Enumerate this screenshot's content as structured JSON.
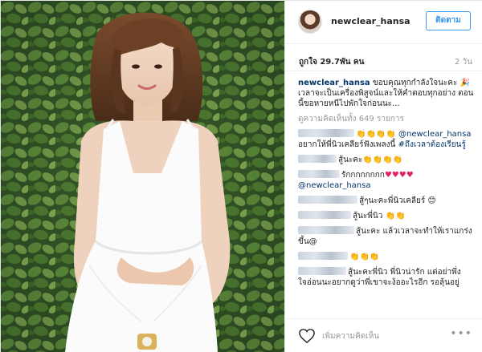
{
  "post": {
    "username": "newclear_hansa",
    "follow_label": "ติดตาม",
    "likes": "ถูกใจ 29.7พัน คน",
    "time": "2 วัน"
  },
  "caption": {
    "user": "newclear_hansa",
    "text": "ขอบคุณทุกกำลังใจนะคะ 🎉 เวลาจะเป็นเครื่องพิสูจน์และให้คำตอบทุกอย่าง ตอนนี้ขอหายหนีไปพักใจก่อนนะ..."
  },
  "view_all": "ดูความคิดเห็นทั้ง 649 รายการ",
  "comments": [
    {
      "emoji": "👏👏👏👏",
      "mention": "@newclear_hansa",
      "text": " อยากให้พี่นิวเคลียร์ฟังเพลงนี้ ",
      "tag": "#ถึงเวลาต้องเรียนรู้"
    },
    {
      "text": "สู้นะคะ👏👏👏👏"
    },
    {
      "text": "รักกกกกกกก",
      "hearts": "♥♥♥♥",
      "mention": "@newclear_hansa"
    },
    {
      "text": "สู้ๆนะคะพี่นิวเคลียร์ 😊"
    },
    {
      "text": "สู้นะพี่นิว 👏👏"
    },
    {
      "text": "สู้นะคะ แล้วเวลาจะทำให้เราแกร่งขึ้น@"
    },
    {
      "text": "👏👏👏"
    },
    {
      "text": "สู้นะคะพี่นิว พี่นิวน่ารัก แต่อย่าพึ่งใจอ่อนนะอยากดูว่าพี่เขาจะง้ออะไรอีก รอลุ้นอยู่"
    }
  ],
  "footer": {
    "placeholder": "เพิ่มความคิดเห็น",
    "more": "•••"
  },
  "colors": {
    "link": "#003569",
    "accent": "#3897f0",
    "muted": "#999999"
  },
  "icons": [
    "heart-outline-icon",
    "more-options-icon"
  ]
}
